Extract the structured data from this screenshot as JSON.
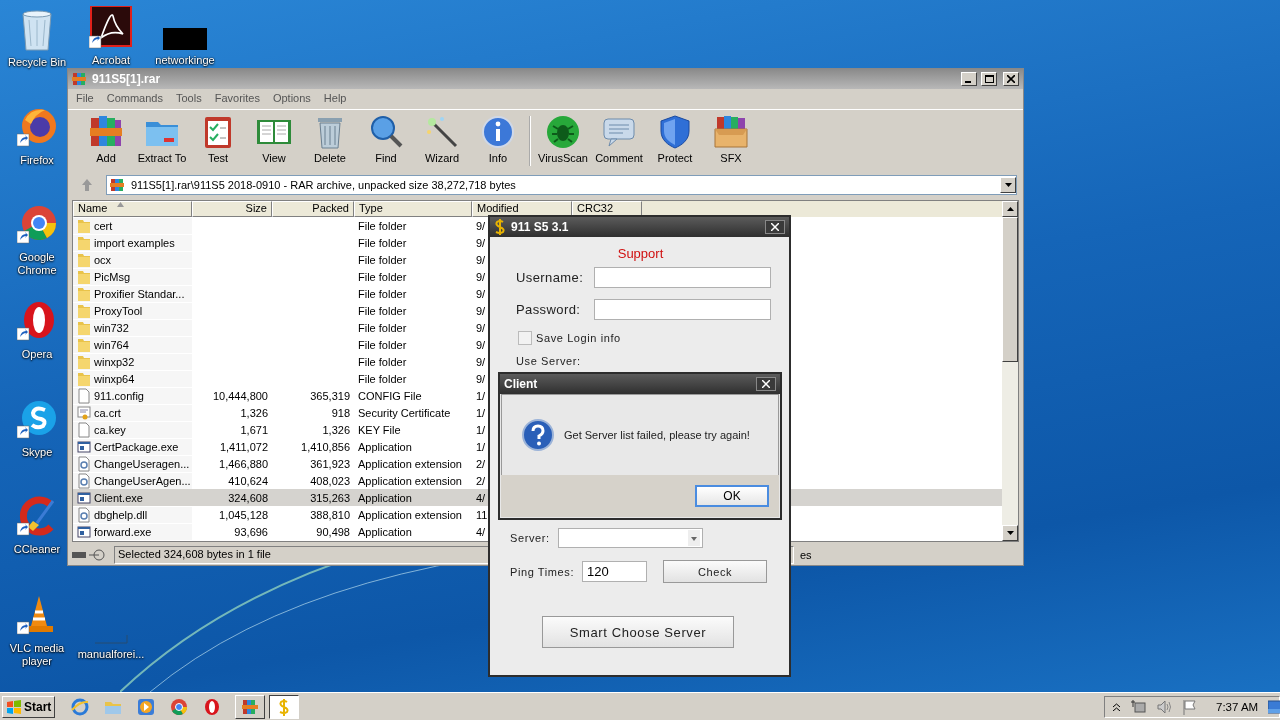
{
  "desktop": {
    "icons": [
      {
        "label": "Recycle Bin",
        "kind": "recycle"
      },
      {
        "label": "Acrobat",
        "kind": "acrobat"
      },
      {
        "label": "networkinge",
        "kind": "dark"
      },
      {
        "label": "Firefox",
        "kind": "firefox"
      },
      {
        "label": "Google Chrome",
        "kind": "chrome"
      },
      {
        "label": "Opera",
        "kind": "opera"
      },
      {
        "label": "Skype",
        "kind": "skype"
      },
      {
        "label": "CCleaner",
        "kind": "ccleaner"
      },
      {
        "label": "VLC media player",
        "kind": "vlc"
      },
      {
        "label": "manualforei...",
        "kind": "blank"
      }
    ]
  },
  "winrar": {
    "title": "911S5[1].rar",
    "menu": [
      "File",
      "Commands",
      "Tools",
      "Favorites",
      "Options",
      "Help"
    ],
    "toolbar": [
      {
        "label": "Add",
        "kind": "add"
      },
      {
        "label": "Extract To",
        "kind": "extract"
      },
      {
        "label": "Test",
        "kind": "test"
      },
      {
        "label": "View",
        "kind": "view"
      },
      {
        "label": "Delete",
        "kind": "delete"
      },
      {
        "label": "Find",
        "kind": "find"
      },
      {
        "label": "Wizard",
        "kind": "wizard"
      },
      {
        "label": "Info",
        "kind": "info"
      },
      {
        "label": "VirusScan",
        "kind": "virus"
      },
      {
        "label": "Comment",
        "kind": "comment"
      },
      {
        "label": "Protect",
        "kind": "protect"
      },
      {
        "label": "SFX",
        "kind": "sfx"
      }
    ],
    "path": "911S5[1].rar\\911S5 2018-0910 - RAR archive, unpacked size 38,272,718 bytes",
    "columns": [
      "Name",
      "Size",
      "Packed",
      "Type",
      "Modified",
      "CRC32"
    ],
    "rows": [
      {
        "name": "cert",
        "size": "",
        "packed": "",
        "type": "File folder",
        "modified": "9/",
        "kind": "folder",
        "selected": false
      },
      {
        "name": "import examples",
        "size": "",
        "packed": "",
        "type": "File folder",
        "modified": "9/",
        "kind": "folder",
        "selected": false
      },
      {
        "name": "ocx",
        "size": "",
        "packed": "",
        "type": "File folder",
        "modified": "9/",
        "kind": "folder",
        "selected": false
      },
      {
        "name": "PicMsg",
        "size": "",
        "packed": "",
        "type": "File folder",
        "modified": "9/",
        "kind": "folder",
        "selected": false
      },
      {
        "name": "Proxifier Standar...",
        "size": "",
        "packed": "",
        "type": "File folder",
        "modified": "9/",
        "kind": "folder",
        "selected": false
      },
      {
        "name": "ProxyTool",
        "size": "",
        "packed": "",
        "type": "File folder",
        "modified": "9/",
        "kind": "folder",
        "selected": false
      },
      {
        "name": "win732",
        "size": "",
        "packed": "",
        "type": "File folder",
        "modified": "9/",
        "kind": "folder",
        "selected": false
      },
      {
        "name": "win764",
        "size": "",
        "packed": "",
        "type": "File folder",
        "modified": "9/",
        "kind": "folder",
        "selected": false
      },
      {
        "name": "winxp32",
        "size": "",
        "packed": "",
        "type": "File folder",
        "modified": "9/",
        "kind": "folder",
        "selected": false
      },
      {
        "name": "winxp64",
        "size": "",
        "packed": "",
        "type": "File folder",
        "modified": "9/",
        "kind": "folder",
        "selected": false
      },
      {
        "name": "911.config",
        "size": "10,444,800",
        "packed": "365,319",
        "type": "CONFIG File",
        "modified": "1/",
        "kind": "file",
        "selected": false
      },
      {
        "name": "ca.crt",
        "size": "1,326",
        "packed": "918",
        "type": "Security Certificate",
        "modified": "1/",
        "kind": "cert",
        "selected": false
      },
      {
        "name": "ca.key",
        "size": "1,671",
        "packed": "1,326",
        "type": "KEY File",
        "modified": "1/",
        "kind": "file",
        "selected": false
      },
      {
        "name": "CertPackage.exe",
        "size": "1,411,072",
        "packed": "1,410,856",
        "type": "Application",
        "modified": "1/",
        "kind": "exe",
        "selected": false
      },
      {
        "name": "ChangeUseragen...",
        "size": "1,466,880",
        "packed": "361,923",
        "type": "Application extension",
        "modified": "2/",
        "kind": "dll",
        "selected": false
      },
      {
        "name": "ChangeUserAgen...",
        "size": "410,624",
        "packed": "408,023",
        "type": "Application extension",
        "modified": "2/",
        "kind": "dll",
        "selected": false
      },
      {
        "name": "Client.exe",
        "size": "324,608",
        "packed": "315,263",
        "type": "Application",
        "modified": "4/",
        "kind": "exe",
        "selected": true
      },
      {
        "name": "dbghelp.dll",
        "size": "1,045,128",
        "packed": "388,810",
        "type": "Application extension",
        "modified": "11",
        "kind": "dll",
        "selected": false
      },
      {
        "name": "forward.exe",
        "size": "93,696",
        "packed": "90,498",
        "type": "Application",
        "modified": "4/",
        "kind": "exe",
        "selected": false
      }
    ],
    "status": "Selected 324,608 bytes in 1 file",
    "status_right": "es"
  },
  "client_window": {
    "title": "911 S5 3.1",
    "support_link": "Support",
    "username_label": "Username:",
    "password_label": "Password:",
    "save_login": {
      "label": "Save Login info",
      "checked": false
    },
    "use_server_label": "Use Server:",
    "server_label": "Server:",
    "ping_label": "Ping Times:",
    "ping_value": "120",
    "check_button": "Check",
    "smart_button": "Smart Choose Server"
  },
  "message_box": {
    "title": "Client",
    "message": "Get Server list failed, please try again!",
    "ok_button": "OK"
  },
  "taskbar": {
    "start": "Start",
    "quick_launch": [
      {
        "kind": "ie"
      },
      {
        "kind": "explorer"
      },
      {
        "kind": "media"
      },
      {
        "kind": "chrome"
      },
      {
        "kind": "opera"
      }
    ],
    "tasks": [
      {
        "kind": "winrar",
        "selected": false
      },
      {
        "kind": "client",
        "selected": true
      }
    ],
    "clock": "7:37 AM"
  }
}
